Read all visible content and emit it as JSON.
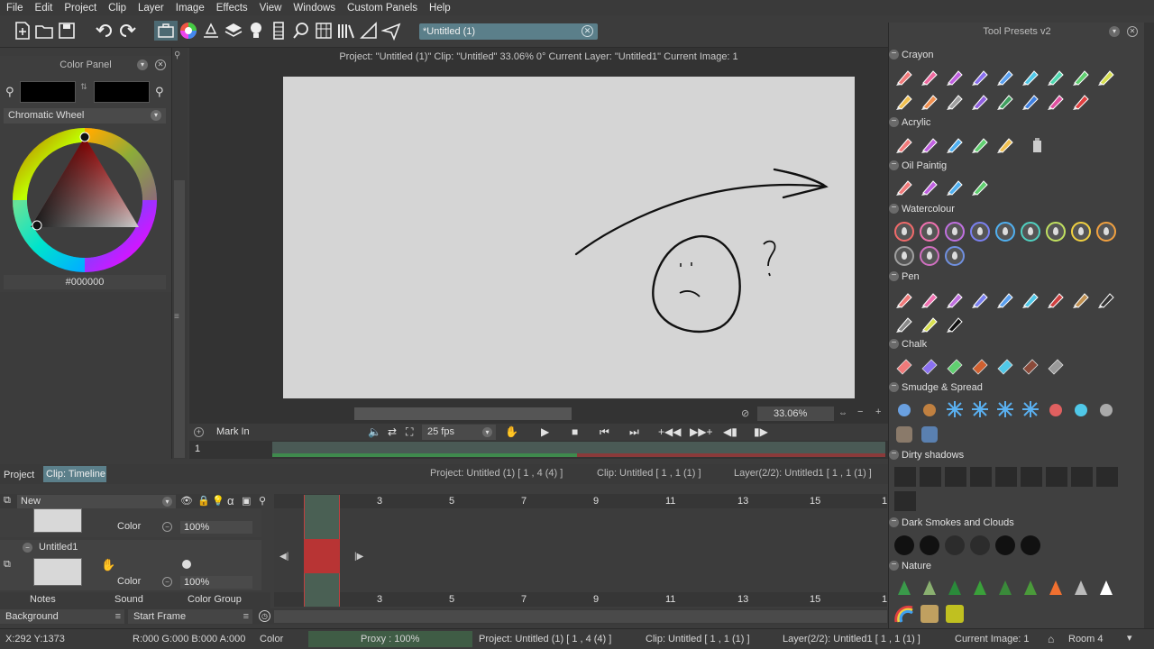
{
  "menu": [
    "File",
    "Edit",
    "Project",
    "Clip",
    "Layer",
    "Image",
    "Effects",
    "View",
    "Windows",
    "Custom Panels",
    "Help"
  ],
  "document_tab": {
    "label": "*Untitled (1)"
  },
  "color_panel": {
    "title": "Color Panel",
    "mode": "Chromatic Wheel",
    "hex": "#000000",
    "primary_color": "#000000",
    "secondary_color": "#000000"
  },
  "canvas": {
    "info": "Project: \"Untitled (1)\" Clip: \"Untitled\"  33.06%  0°  Current Layer: \"Untitled1\"  Current Image: 1",
    "zoom": "33.06%",
    "background": "#d5d5d5"
  },
  "playback": {
    "mark_in": "Mark In",
    "fps": "25 fps",
    "frame": "1"
  },
  "timeline": {
    "tab_project": "Project",
    "tab_timeline": "Clip: Timeline",
    "info_project": "Project: Untitled (1) [ 1 , 4  (4) ]",
    "info_clip": "Clip: Untitled [ 1 , 1  (1) ]",
    "info_layer": "Layer(2/2): Untitled1 [ 1 , 1  (1) ]",
    "new_layer_label": "New",
    "ruler": [
      "1",
      "3",
      "5",
      "7",
      "9",
      "11",
      "13",
      "15",
      "1"
    ],
    "layers": [
      {
        "name": "",
        "mode": "Color",
        "opacity": "100%"
      },
      {
        "name": "Untitled1",
        "mode": "Color",
        "opacity": "100%"
      }
    ],
    "cell_marks": [
      "1.",
      "1."
    ],
    "bottom_tabs": [
      "Notes",
      "Sound",
      "Color Group"
    ],
    "background_label": "Background",
    "start_frame_label": "Start Frame"
  },
  "status": {
    "coords": "X:292  Y:1373",
    "rgba": "R:000 G:000 B:000 A:000",
    "mode": "Color",
    "proxy": "Proxy : 100%",
    "project": "Project: Untitled (1) [ 1 , 4  (4) ]",
    "clip": "Clip: Untitled [ 1 , 1  (1) ]",
    "layer": "Layer(2/2): Untitled1 [ 1 , 1  (1) ]",
    "current_image": "Current Image: 1",
    "room": "Room 4"
  },
  "presets": {
    "title": "Tool Presets v2",
    "sections": [
      "Crayon",
      "Acrylic",
      "Oil Paintig",
      "Watercolour",
      "Pen",
      "Chalk",
      "Smudge & Spread",
      "Dirty shadows",
      "Dark Smokes and Clouds",
      "Nature"
    ],
    "crayon_colors": [
      "#f07a7a",
      "#f06aa0",
      "#c060e0",
      "#8a70f0",
      "#5aa0f0",
      "#50c8e8",
      "#50d8b0",
      "#60d070",
      "#d8e050",
      "#f0c050",
      "#f09050",
      "#a0a0a0",
      "#9060e0",
      "#40a060",
      "#4080e0",
      "#e050a0",
      "#e04040"
    ],
    "watercolor_colors": [
      "#f06a6a",
      "#f070b0",
      "#c070e0",
      "#7a80f0",
      "#50b0f0",
      "#50d0c0",
      "#c0e060",
      "#f0d040",
      "#f0a040",
      "#a0a0a0",
      "#d070c0",
      "#7090e0"
    ]
  }
}
